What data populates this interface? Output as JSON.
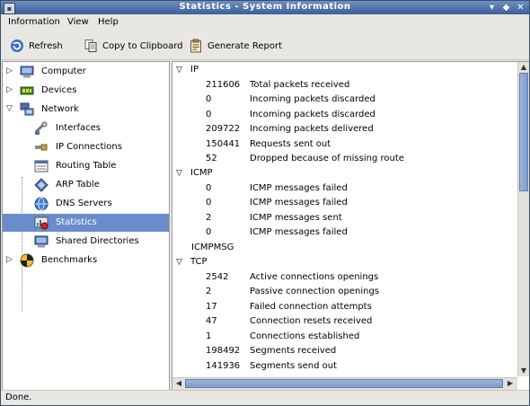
{
  "window": {
    "title": "Statistics - System Information",
    "controls": [
      "down-arrow",
      "restore",
      "close"
    ]
  },
  "menubar": {
    "items": [
      {
        "label": "Information"
      },
      {
        "label": "View"
      },
      {
        "label": "Help"
      }
    ]
  },
  "toolbar": {
    "refresh_label": "Refresh",
    "copy_label": "Copy to Clipboard",
    "report_label": "Generate Report"
  },
  "sidebar": {
    "items": [
      {
        "label": "Computer",
        "icon": "computer-icon",
        "expander": "collapsed"
      },
      {
        "label": "Devices",
        "icon": "devices-icon",
        "expander": "collapsed"
      },
      {
        "label": "Network",
        "icon": "network-icon",
        "expander": "expanded"
      },
      {
        "label": "Interfaces",
        "icon": "interfaces-icon"
      },
      {
        "label": "IP Connections",
        "icon": "ip-connections-icon"
      },
      {
        "label": "Routing Table",
        "icon": "routing-table-icon"
      },
      {
        "label": "ARP Table",
        "icon": "arp-table-icon"
      },
      {
        "label": "DNS Servers",
        "icon": "dns-servers-icon"
      },
      {
        "label": "Statistics",
        "icon": "statistics-icon",
        "selected": true
      },
      {
        "label": "Shared Directories",
        "icon": "shared-directories-icon"
      },
      {
        "label": "Benchmarks",
        "icon": "benchmarks-icon",
        "expander": "collapsed"
      }
    ]
  },
  "content": {
    "sections": [
      {
        "title": "IP",
        "rows": [
          {
            "value": "211606",
            "label": "Total packets received"
          },
          {
            "value": "0",
            "label": "Incoming packets discarded"
          },
          {
            "value": "0",
            "label": "Incoming packets discarded"
          },
          {
            "value": "209722",
            "label": "Incoming packets delivered"
          },
          {
            "value": "150441",
            "label": "Requests sent out"
          },
          {
            "value": "52",
            "label": "Dropped because of missing route"
          }
        ]
      },
      {
        "title": "ICMP",
        "rows": [
          {
            "value": "0",
            "label": "ICMP messages failed"
          },
          {
            "value": "0",
            "label": "ICMP messages failed"
          },
          {
            "value": "2",
            "label": "ICMP messages sent"
          },
          {
            "value": "0",
            "label": "ICMP messages failed"
          }
        ]
      },
      {
        "title": "ICMPMSG",
        "rows": []
      },
      {
        "title": "TCP",
        "rows": [
          {
            "value": "2542",
            "label": "Active connections openings"
          },
          {
            "value": "2",
            "label": "Passive connection openings"
          },
          {
            "value": "17",
            "label": "Failed connection attempts"
          },
          {
            "value": "47",
            "label": "Connection resets received"
          },
          {
            "value": "1",
            "label": "Connections established"
          },
          {
            "value": "198492",
            "label": "Segments received"
          },
          {
            "value": "141936",
            "label": "Segments send out"
          }
        ]
      }
    ]
  },
  "statusbar": {
    "text": "Done."
  },
  "colors": {
    "selection": "#6a8ccc",
    "titlebar": "#4a6aa5",
    "scroll_thumb": "#8aa4d2"
  }
}
